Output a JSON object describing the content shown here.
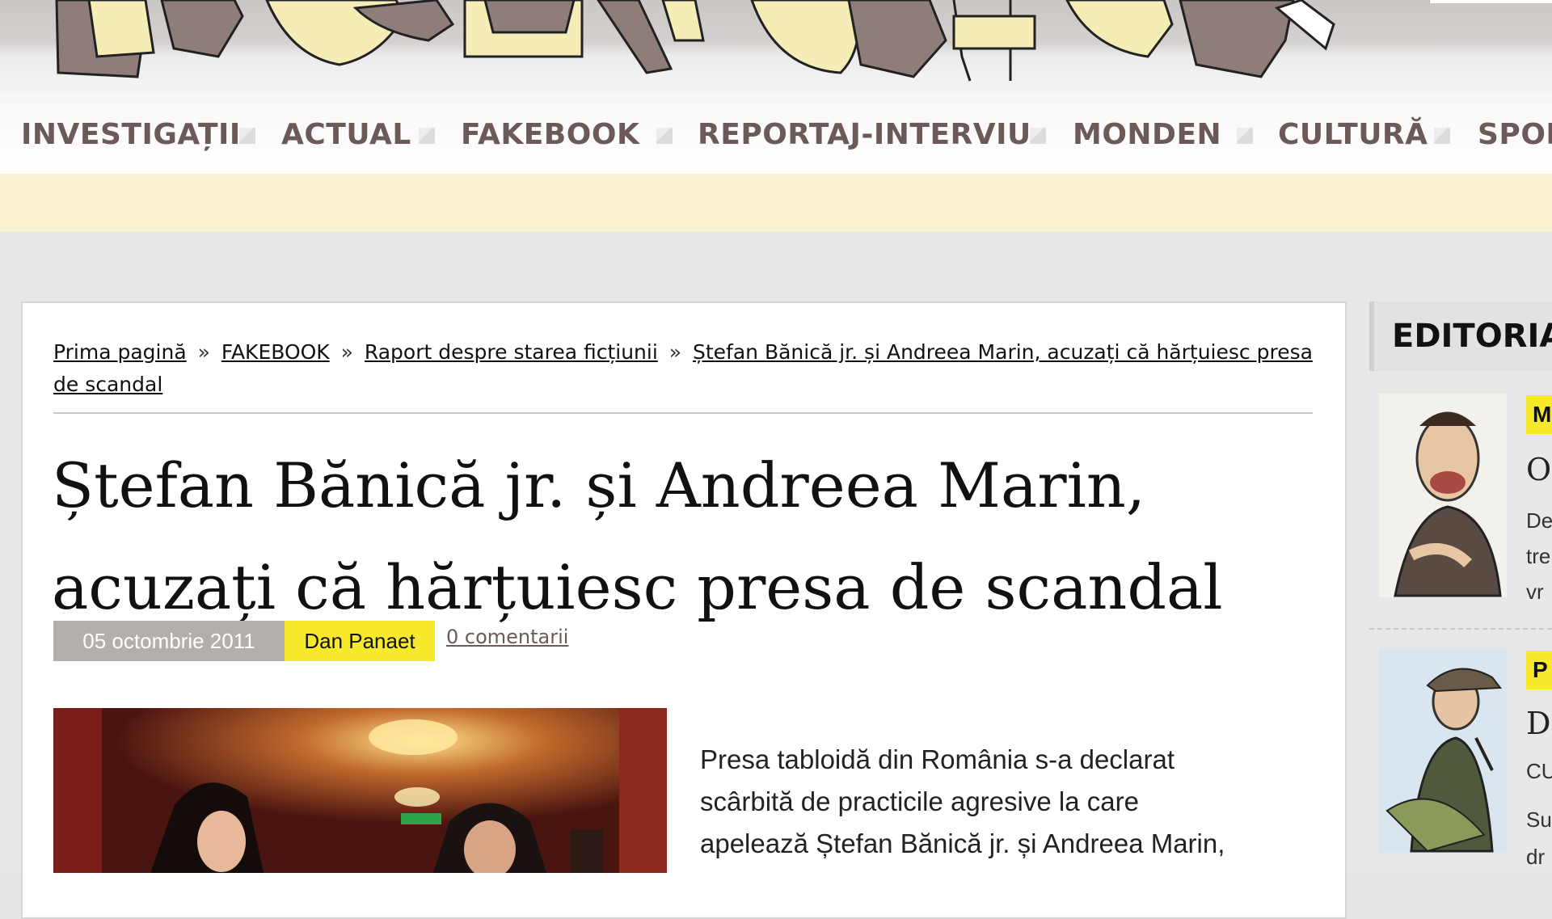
{
  "nav": {
    "items": [
      "INVESTIGAȚII",
      "ACTUAL",
      "FAKEBOOK",
      "REPORTAJ-INTERVIU",
      "MONDEN",
      "CULTURĂ",
      "SPOR"
    ]
  },
  "breadcrumb": {
    "home": "Prima pagină",
    "sep": "»",
    "section": "FAKEBOOK",
    "category": "Raport despre starea ficțiunii",
    "current": "Ștefan Bănică jr. și Andreea Marin, acuzați că hărțuiesc presa de scandal"
  },
  "article": {
    "title": "Ștefan Bănică jr. și Andreea Marin, acuzați că hărțuiesc presa de scandal",
    "date": "05 octombrie 2011",
    "author": "Dan Panaet",
    "comments": "0 comentarii",
    "paragraph_lines": [
      "Presa tabloidă din România s-a declarat",
      "scârbită de practicile agresive la care",
      "apelează Ștefan Bănică jr. și Andreea Marin,"
    ]
  },
  "sidebar": {
    "heading": "EDITORIA",
    "items": [
      {
        "tag": "M",
        "title": "O",
        "lines": [
          "De",
          "tre",
          "vr"
        ]
      },
      {
        "tag": "P",
        "title": "D",
        "lines": [
          "CU",
          "Su",
          "dr"
        ]
      }
    ]
  },
  "colors": {
    "nav_text": "#6b5a57",
    "accent_yellow": "#f7ea2c",
    "date_badge": "#b4afad",
    "yellow_band": "#f8f2ce"
  }
}
